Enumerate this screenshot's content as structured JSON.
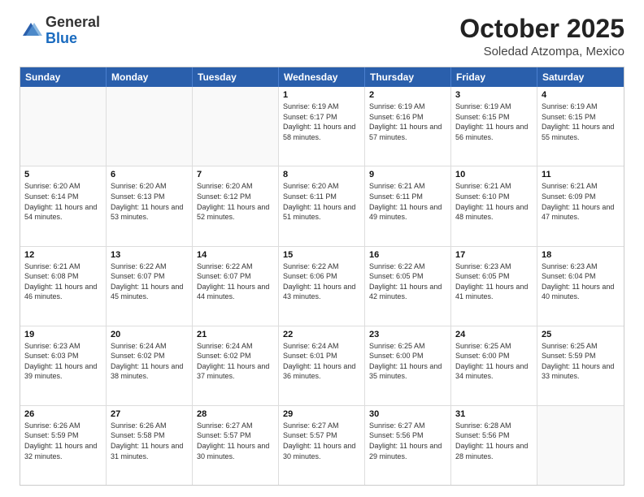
{
  "logo": {
    "general": "General",
    "blue": "Blue"
  },
  "header": {
    "month": "October 2025",
    "location": "Soledad Atzompa, Mexico"
  },
  "weekdays": [
    "Sunday",
    "Monday",
    "Tuesday",
    "Wednesday",
    "Thursday",
    "Friday",
    "Saturday"
  ],
  "weeks": [
    [
      {
        "day": "",
        "empty": true
      },
      {
        "day": "",
        "empty": true
      },
      {
        "day": "",
        "empty": true
      },
      {
        "day": "1",
        "sunrise": "Sunrise: 6:19 AM",
        "sunset": "Sunset: 6:17 PM",
        "daylight": "Daylight: 11 hours and 58 minutes."
      },
      {
        "day": "2",
        "sunrise": "Sunrise: 6:19 AM",
        "sunset": "Sunset: 6:16 PM",
        "daylight": "Daylight: 11 hours and 57 minutes."
      },
      {
        "day": "3",
        "sunrise": "Sunrise: 6:19 AM",
        "sunset": "Sunset: 6:15 PM",
        "daylight": "Daylight: 11 hours and 56 minutes."
      },
      {
        "day": "4",
        "sunrise": "Sunrise: 6:19 AM",
        "sunset": "Sunset: 6:15 PM",
        "daylight": "Daylight: 11 hours and 55 minutes."
      }
    ],
    [
      {
        "day": "5",
        "sunrise": "Sunrise: 6:20 AM",
        "sunset": "Sunset: 6:14 PM",
        "daylight": "Daylight: 11 hours and 54 minutes."
      },
      {
        "day": "6",
        "sunrise": "Sunrise: 6:20 AM",
        "sunset": "Sunset: 6:13 PM",
        "daylight": "Daylight: 11 hours and 53 minutes."
      },
      {
        "day": "7",
        "sunrise": "Sunrise: 6:20 AM",
        "sunset": "Sunset: 6:12 PM",
        "daylight": "Daylight: 11 hours and 52 minutes."
      },
      {
        "day": "8",
        "sunrise": "Sunrise: 6:20 AM",
        "sunset": "Sunset: 6:11 PM",
        "daylight": "Daylight: 11 hours and 51 minutes."
      },
      {
        "day": "9",
        "sunrise": "Sunrise: 6:21 AM",
        "sunset": "Sunset: 6:11 PM",
        "daylight": "Daylight: 11 hours and 49 minutes."
      },
      {
        "day": "10",
        "sunrise": "Sunrise: 6:21 AM",
        "sunset": "Sunset: 6:10 PM",
        "daylight": "Daylight: 11 hours and 48 minutes."
      },
      {
        "day": "11",
        "sunrise": "Sunrise: 6:21 AM",
        "sunset": "Sunset: 6:09 PM",
        "daylight": "Daylight: 11 hours and 47 minutes."
      }
    ],
    [
      {
        "day": "12",
        "sunrise": "Sunrise: 6:21 AM",
        "sunset": "Sunset: 6:08 PM",
        "daylight": "Daylight: 11 hours and 46 minutes."
      },
      {
        "day": "13",
        "sunrise": "Sunrise: 6:22 AM",
        "sunset": "Sunset: 6:07 PM",
        "daylight": "Daylight: 11 hours and 45 minutes."
      },
      {
        "day": "14",
        "sunrise": "Sunrise: 6:22 AM",
        "sunset": "Sunset: 6:07 PM",
        "daylight": "Daylight: 11 hours and 44 minutes."
      },
      {
        "day": "15",
        "sunrise": "Sunrise: 6:22 AM",
        "sunset": "Sunset: 6:06 PM",
        "daylight": "Daylight: 11 hours and 43 minutes."
      },
      {
        "day": "16",
        "sunrise": "Sunrise: 6:22 AM",
        "sunset": "Sunset: 6:05 PM",
        "daylight": "Daylight: 11 hours and 42 minutes."
      },
      {
        "day": "17",
        "sunrise": "Sunrise: 6:23 AM",
        "sunset": "Sunset: 6:05 PM",
        "daylight": "Daylight: 11 hours and 41 minutes."
      },
      {
        "day": "18",
        "sunrise": "Sunrise: 6:23 AM",
        "sunset": "Sunset: 6:04 PM",
        "daylight": "Daylight: 11 hours and 40 minutes."
      }
    ],
    [
      {
        "day": "19",
        "sunrise": "Sunrise: 6:23 AM",
        "sunset": "Sunset: 6:03 PM",
        "daylight": "Daylight: 11 hours and 39 minutes."
      },
      {
        "day": "20",
        "sunrise": "Sunrise: 6:24 AM",
        "sunset": "Sunset: 6:02 PM",
        "daylight": "Daylight: 11 hours and 38 minutes."
      },
      {
        "day": "21",
        "sunrise": "Sunrise: 6:24 AM",
        "sunset": "Sunset: 6:02 PM",
        "daylight": "Daylight: 11 hours and 37 minutes."
      },
      {
        "day": "22",
        "sunrise": "Sunrise: 6:24 AM",
        "sunset": "Sunset: 6:01 PM",
        "daylight": "Daylight: 11 hours and 36 minutes."
      },
      {
        "day": "23",
        "sunrise": "Sunrise: 6:25 AM",
        "sunset": "Sunset: 6:00 PM",
        "daylight": "Daylight: 11 hours and 35 minutes."
      },
      {
        "day": "24",
        "sunrise": "Sunrise: 6:25 AM",
        "sunset": "Sunset: 6:00 PM",
        "daylight": "Daylight: 11 hours and 34 minutes."
      },
      {
        "day": "25",
        "sunrise": "Sunrise: 6:25 AM",
        "sunset": "Sunset: 5:59 PM",
        "daylight": "Daylight: 11 hours and 33 minutes."
      }
    ],
    [
      {
        "day": "26",
        "sunrise": "Sunrise: 6:26 AM",
        "sunset": "Sunset: 5:59 PM",
        "daylight": "Daylight: 11 hours and 32 minutes."
      },
      {
        "day": "27",
        "sunrise": "Sunrise: 6:26 AM",
        "sunset": "Sunset: 5:58 PM",
        "daylight": "Daylight: 11 hours and 31 minutes."
      },
      {
        "day": "28",
        "sunrise": "Sunrise: 6:27 AM",
        "sunset": "Sunset: 5:57 PM",
        "daylight": "Daylight: 11 hours and 30 minutes."
      },
      {
        "day": "29",
        "sunrise": "Sunrise: 6:27 AM",
        "sunset": "Sunset: 5:57 PM",
        "daylight": "Daylight: 11 hours and 30 minutes."
      },
      {
        "day": "30",
        "sunrise": "Sunrise: 6:27 AM",
        "sunset": "Sunset: 5:56 PM",
        "daylight": "Daylight: 11 hours and 29 minutes."
      },
      {
        "day": "31",
        "sunrise": "Sunrise: 6:28 AM",
        "sunset": "Sunset: 5:56 PM",
        "daylight": "Daylight: 11 hours and 28 minutes."
      },
      {
        "day": "",
        "empty": true
      }
    ]
  ]
}
